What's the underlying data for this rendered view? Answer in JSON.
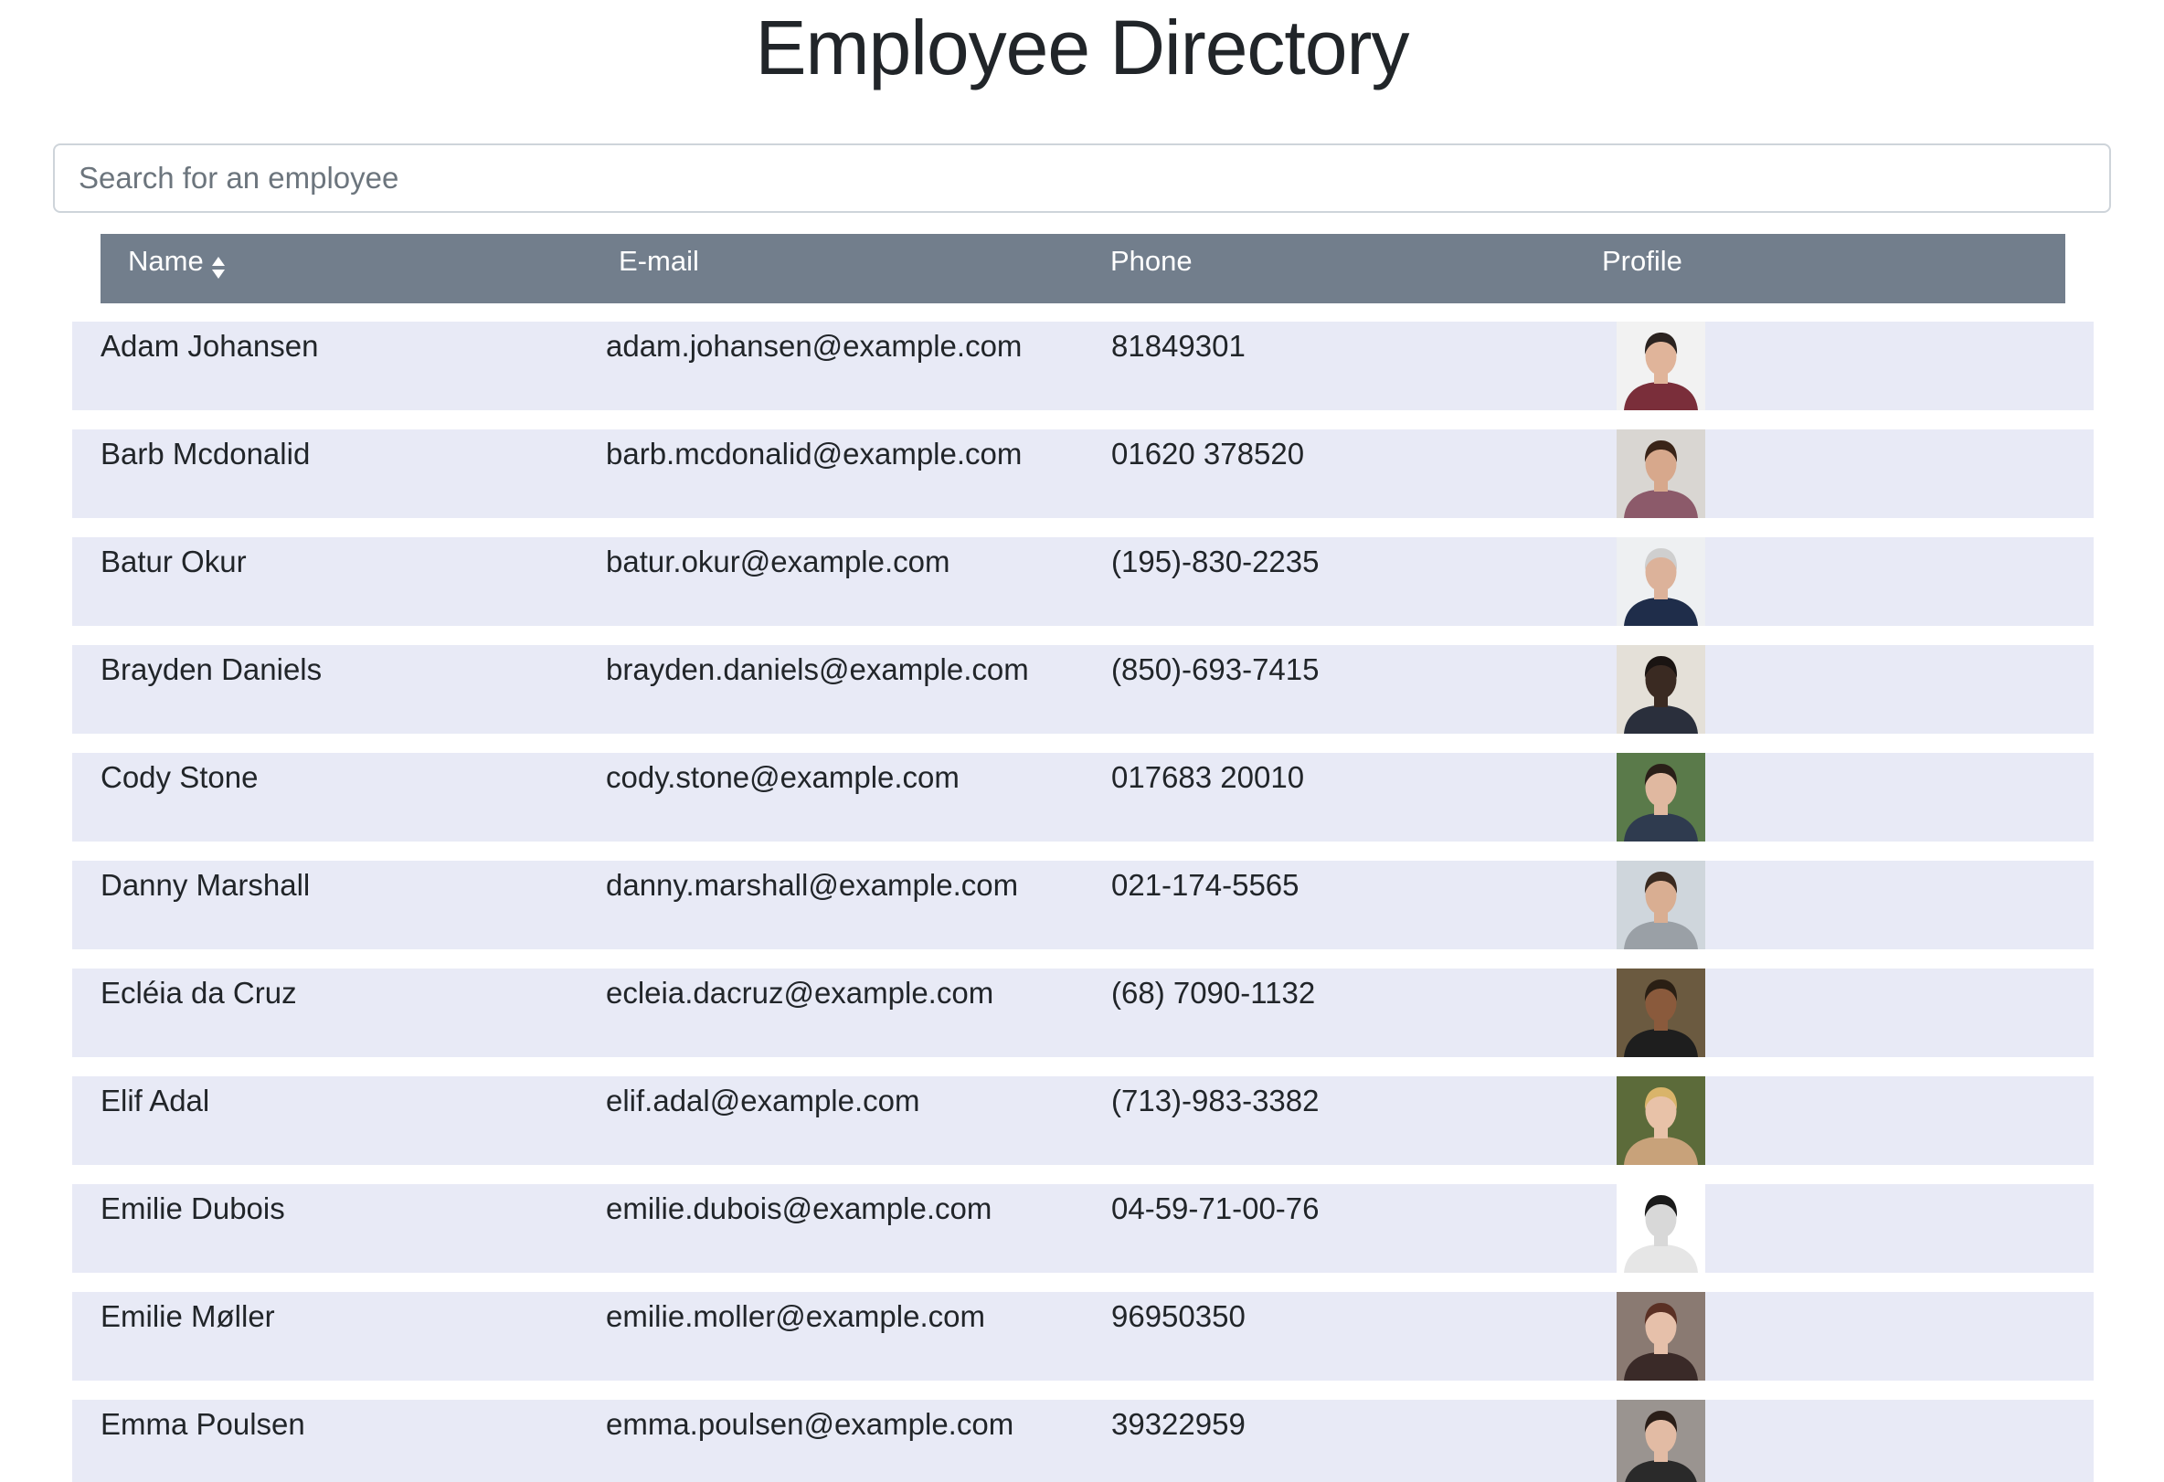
{
  "header": {
    "title": "Employee Directory"
  },
  "search": {
    "placeholder": "Search for an employee"
  },
  "table": {
    "columns": [
      {
        "label": "Name",
        "sortable": true,
        "icon": "sort-icon"
      },
      {
        "label": "E-mail"
      },
      {
        "label": "Phone"
      },
      {
        "label": "Profile"
      }
    ],
    "rows": [
      {
        "name": "Adam Johansen",
        "email": "adam.johansen@example.com",
        "phone": "81849301",
        "avatar": {
          "bg": "#f2f2f2",
          "skin": "#e0b49a",
          "hair": "#2b2320",
          "shirt": "#7a2e3a"
        }
      },
      {
        "name": "Barb Mcdonalid",
        "email": "barb.mcdonalid@example.com",
        "phone": "01620 378520",
        "avatar": {
          "bg": "#d9d6d2",
          "skin": "#d7a88c",
          "hair": "#3a2418",
          "shirt": "#8c5a6a"
        }
      },
      {
        "name": "Batur Okur",
        "email": "batur.okur@example.com",
        "phone": "(195)-830-2235",
        "avatar": {
          "bg": "#eef0f2",
          "skin": "#dcb29a",
          "hair": "#cfcfcf",
          "shirt": "#1f2d4a"
        }
      },
      {
        "name": "Brayden Daniels",
        "email": "brayden.daniels@example.com",
        "phone": "(850)-693-7415",
        "avatar": {
          "bg": "#e4e0d8",
          "skin": "#3a2a22",
          "hair": "#1a1412",
          "shirt": "#2a2f3c"
        }
      },
      {
        "name": "Cody Stone",
        "email": "cody.stone@example.com",
        "phone": "017683 20010",
        "avatar": {
          "bg": "#5a7a4a",
          "skin": "#e0b8a0",
          "hair": "#2a1f18",
          "shirt": "#2f3b4f"
        }
      },
      {
        "name": "Danny Marshall",
        "email": "danny.marshall@example.com",
        "phone": "021-174-5565",
        "avatar": {
          "bg": "#cfd6dc",
          "skin": "#d9ae92",
          "hair": "#3a2a20",
          "shirt": "#9aa0a6"
        }
      },
      {
        "name": "Ecléia da Cruz",
        "email": "ecleia.dacruz@example.com",
        "phone": "(68) 7090-1132",
        "avatar": {
          "bg": "#6b5a40",
          "skin": "#8a5a3c",
          "hair": "#2a1f14",
          "shirt": "#1e1e1e"
        }
      },
      {
        "name": "Elif Adal",
        "email": "elif.adal@example.com",
        "phone": "(713)-983-3382",
        "avatar": {
          "bg": "#5c6b3a",
          "skin": "#e8c2a8",
          "hair": "#d9b46a",
          "shirt": "#c8a27a"
        }
      },
      {
        "name": "Emilie Dubois",
        "email": "emilie.dubois@example.com",
        "phone": "04-59-71-00-76",
        "avatar": {
          "bg": "#ffffff",
          "skin": "#d8d8d8",
          "hair": "#1a1a1a",
          "shirt": "#e6e6e6"
        }
      },
      {
        "name": "Emilie Møller",
        "email": "emilie.moller@example.com",
        "phone": "96950350",
        "avatar": {
          "bg": "#8a7a72",
          "skin": "#e6c0aa",
          "hair": "#5a3024",
          "shirt": "#3a2a28"
        }
      },
      {
        "name": "Emma Poulsen",
        "email": "emma.poulsen@example.com",
        "phone": "39322959",
        "avatar": {
          "bg": "#9a9490",
          "skin": "#e2bba4",
          "hair": "#2a1e18",
          "shirt": "#2a2a2a"
        }
      }
    ]
  }
}
